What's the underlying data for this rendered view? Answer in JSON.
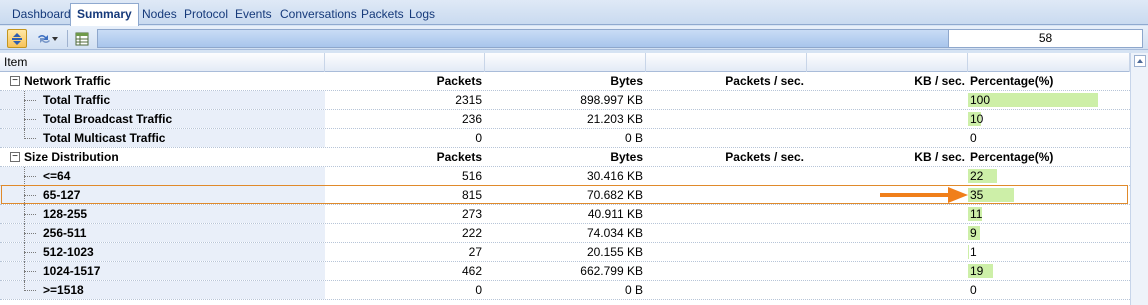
{
  "tabs": [
    {
      "label": "Dashboard",
      "active": false
    },
    {
      "label": "Summary",
      "active": true
    },
    {
      "label": "Nodes",
      "active": false
    },
    {
      "label": "Protocol",
      "active": false
    },
    {
      "label": "Events",
      "active": false
    },
    {
      "label": "Conversations",
      "active": false
    },
    {
      "label": "Packets",
      "active": false
    },
    {
      "label": "Logs",
      "active": false
    }
  ],
  "toolbar": {
    "icons": [
      "expand-collapse-icon",
      "refresh-options-icon",
      "dropdown-icon",
      "view-table-icon"
    ],
    "progress_value": "58"
  },
  "grid": {
    "columns": [
      "Item",
      "",
      "",
      "",
      "",
      ""
    ],
    "groups": [
      {
        "label": "Network Traffic",
        "headers": {
          "packets": "Packets",
          "bytes": "Bytes",
          "pps": "Packets / sec.",
          "kbps": "KB / sec.",
          "pct": "Percentage(%)"
        },
        "rows": [
          {
            "name": "Total Traffic",
            "packets": "2315",
            "bytes": "898.997 KB",
            "pct": "100",
            "pct_value": 100
          },
          {
            "name": "Total Broadcast Traffic",
            "packets": "236",
            "bytes": "21.203 KB",
            "pct": "10",
            "pct_value": 10
          },
          {
            "name": "Total Multicast Traffic",
            "packets": "0",
            "bytes": "0 B",
            "pct": "0",
            "pct_value": 0
          }
        ]
      },
      {
        "label": "Size Distribution",
        "headers": {
          "packets": "Packets",
          "bytes": "Bytes",
          "pps": "Packets / sec.",
          "kbps": "KB / sec.",
          "pct": "Percentage(%)"
        },
        "rows": [
          {
            "name": "<=64",
            "packets": "516",
            "bytes": "30.416 KB",
            "pct": "22",
            "pct_value": 22
          },
          {
            "name": "65-127",
            "packets": "815",
            "bytes": "70.682 KB",
            "pct": "35",
            "pct_value": 35
          },
          {
            "name": "128-255",
            "packets": "273",
            "bytes": "40.911 KB",
            "pct": "11",
            "pct_value": 11
          },
          {
            "name": "256-511",
            "packets": "222",
            "bytes": "74.034 KB",
            "pct": "9",
            "pct_value": 9
          },
          {
            "name": "512-1023",
            "packets": "27",
            "bytes": "20.155 KB",
            "pct": "1",
            "pct_value": 1
          },
          {
            "name": "1024-1517",
            "packets": "462",
            "bytes": "662.799 KB",
            "pct": "19",
            "pct_value": 19
          },
          {
            "name": ">=1518",
            "packets": "0",
            "bytes": "0 B",
            "pct": "0",
            "pct_value": 0
          }
        ]
      }
    ]
  },
  "highlight": {
    "row_name": "65-127",
    "arrow_color": "#f07f1a",
    "border_color": "#e08a2b"
  },
  "colors": {
    "pct_bar": "#cdefa8",
    "tab_text": "#15397a"
  }
}
